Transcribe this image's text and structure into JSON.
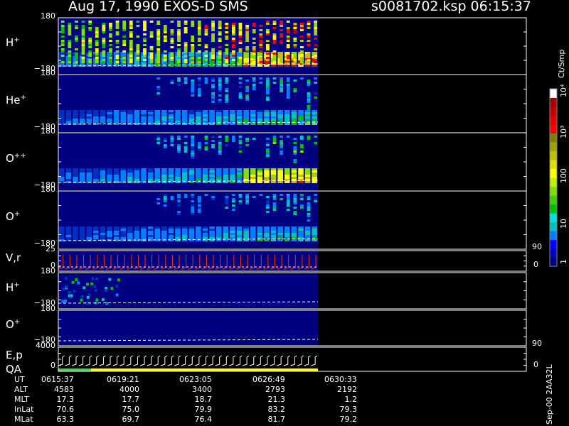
{
  "header": {
    "title_left": "Aug 17, 1990   EXOS-D SMS",
    "title_right": "s0081702.ksp  06:15:37"
  },
  "panels": [
    {
      "id": "h-plus",
      "label": "H",
      "sup": "+",
      "top_tick": "180",
      "bottom_tick": "-180"
    },
    {
      "id": "he-plus",
      "label": "He",
      "sup": "+",
      "top_tick": "180",
      "bottom_tick": "-180"
    },
    {
      "id": "o-plusplus",
      "label": "O",
      "sup": "++",
      "top_tick": "180",
      "bottom_tick": "-180"
    },
    {
      "id": "o-plus",
      "label": "O",
      "sup": "+",
      "top_tick": "180",
      "bottom_tick": "-180"
    },
    {
      "id": "vr",
      "label": "V,r",
      "sup": "",
      "top_tick": "25",
      "bottom_tick": "0",
      "right_top": "90",
      "right_bottom": "0"
    },
    {
      "id": "h-plus-2",
      "label": "H",
      "sup": "+",
      "top_tick": "180",
      "bottom_tick": "-180"
    },
    {
      "id": "o-plus-2",
      "label": "O",
      "sup": "+",
      "top_tick": "180",
      "bottom_tick": "-180"
    },
    {
      "id": "ep-qa",
      "label": "E,p",
      "label2": "QA",
      "sup": "",
      "top_tick": "4000",
      "bottom_tick": "0",
      "right_top": "90",
      "right_bottom": "0"
    }
  ],
  "colorbar": {
    "unit": "Ct/Smp",
    "ticks": [
      "1",
      "10",
      "100",
      "10³",
      "10⁴"
    ],
    "colors": [
      "#000080",
      "#0000c0",
      "#0000ff",
      "#0080ff",
      "#00c0c0",
      "#00e0e0",
      "#00c000",
      "#40d000",
      "#80e000",
      "#c0f000",
      "#ffff00",
      "#e0e000",
      "#c0c000",
      "#a0a000",
      "#808000",
      "#ff0000",
      "#e00000",
      "#c00000",
      "#a00000",
      "#ffffff"
    ]
  },
  "footer": {
    "ut_label": "UT",
    "rows": [
      {
        "label": "UT",
        "values": [
          "0615:37",
          "0619:21",
          "0623:05",
          "0626:49",
          "0630:33"
        ]
      },
      {
        "label": "ALT",
        "values": [
          "4583",
          "4000",
          "3400",
          "2793",
          "2192"
        ]
      },
      {
        "label": "MLT",
        "values": [
          "17.3",
          "17.7",
          "18.7",
          "21.3",
          "1.2"
        ]
      },
      {
        "label": "InLat",
        "values": [
          "70.6",
          "75.0",
          "79.9",
          "83.2",
          "79.3"
        ]
      },
      {
        "label": "MLat",
        "values": [
          "63.3",
          "69.7",
          "76.4",
          "81.7",
          "79.2"
        ]
      }
    ],
    "stamp": "Sep-00 2AA32L"
  },
  "chart_data": {
    "type": "heatmap",
    "title": "Aug 17, 1990   EXOS-D SMS",
    "subtitle": "s0081702.ksp  06:15:37",
    "x": [
      "0615:37",
      "0619:21",
      "0623:05",
      "0626:49",
      "0630:33"
    ],
    "colorbar_label": "Ct/Smp",
    "colorbar_range": [
      1,
      10000
    ],
    "colorbar_scale": "log",
    "grid": false,
    "series": [
      {
        "name": "H+",
        "ylim": [
          -180,
          180
        ]
      },
      {
        "name": "He+",
        "ylim": [
          -180,
          180
        ]
      },
      {
        "name": "O++",
        "ylim": [
          -180,
          180
        ]
      },
      {
        "name": "O+",
        "ylim": [
          -180,
          180
        ]
      },
      {
        "name": "V,r",
        "ylim": [
          0,
          25
        ],
        "right_ylim": [
          0,
          90
        ]
      },
      {
        "name": "H+",
        "ylim": [
          -180,
          180
        ]
      },
      {
        "name": "O+",
        "ylim": [
          -180,
          180
        ]
      },
      {
        "name": "E,p",
        "ylim": [
          0,
          4000
        ],
        "right_ylim": [
          0,
          90
        ]
      }
    ]
  }
}
